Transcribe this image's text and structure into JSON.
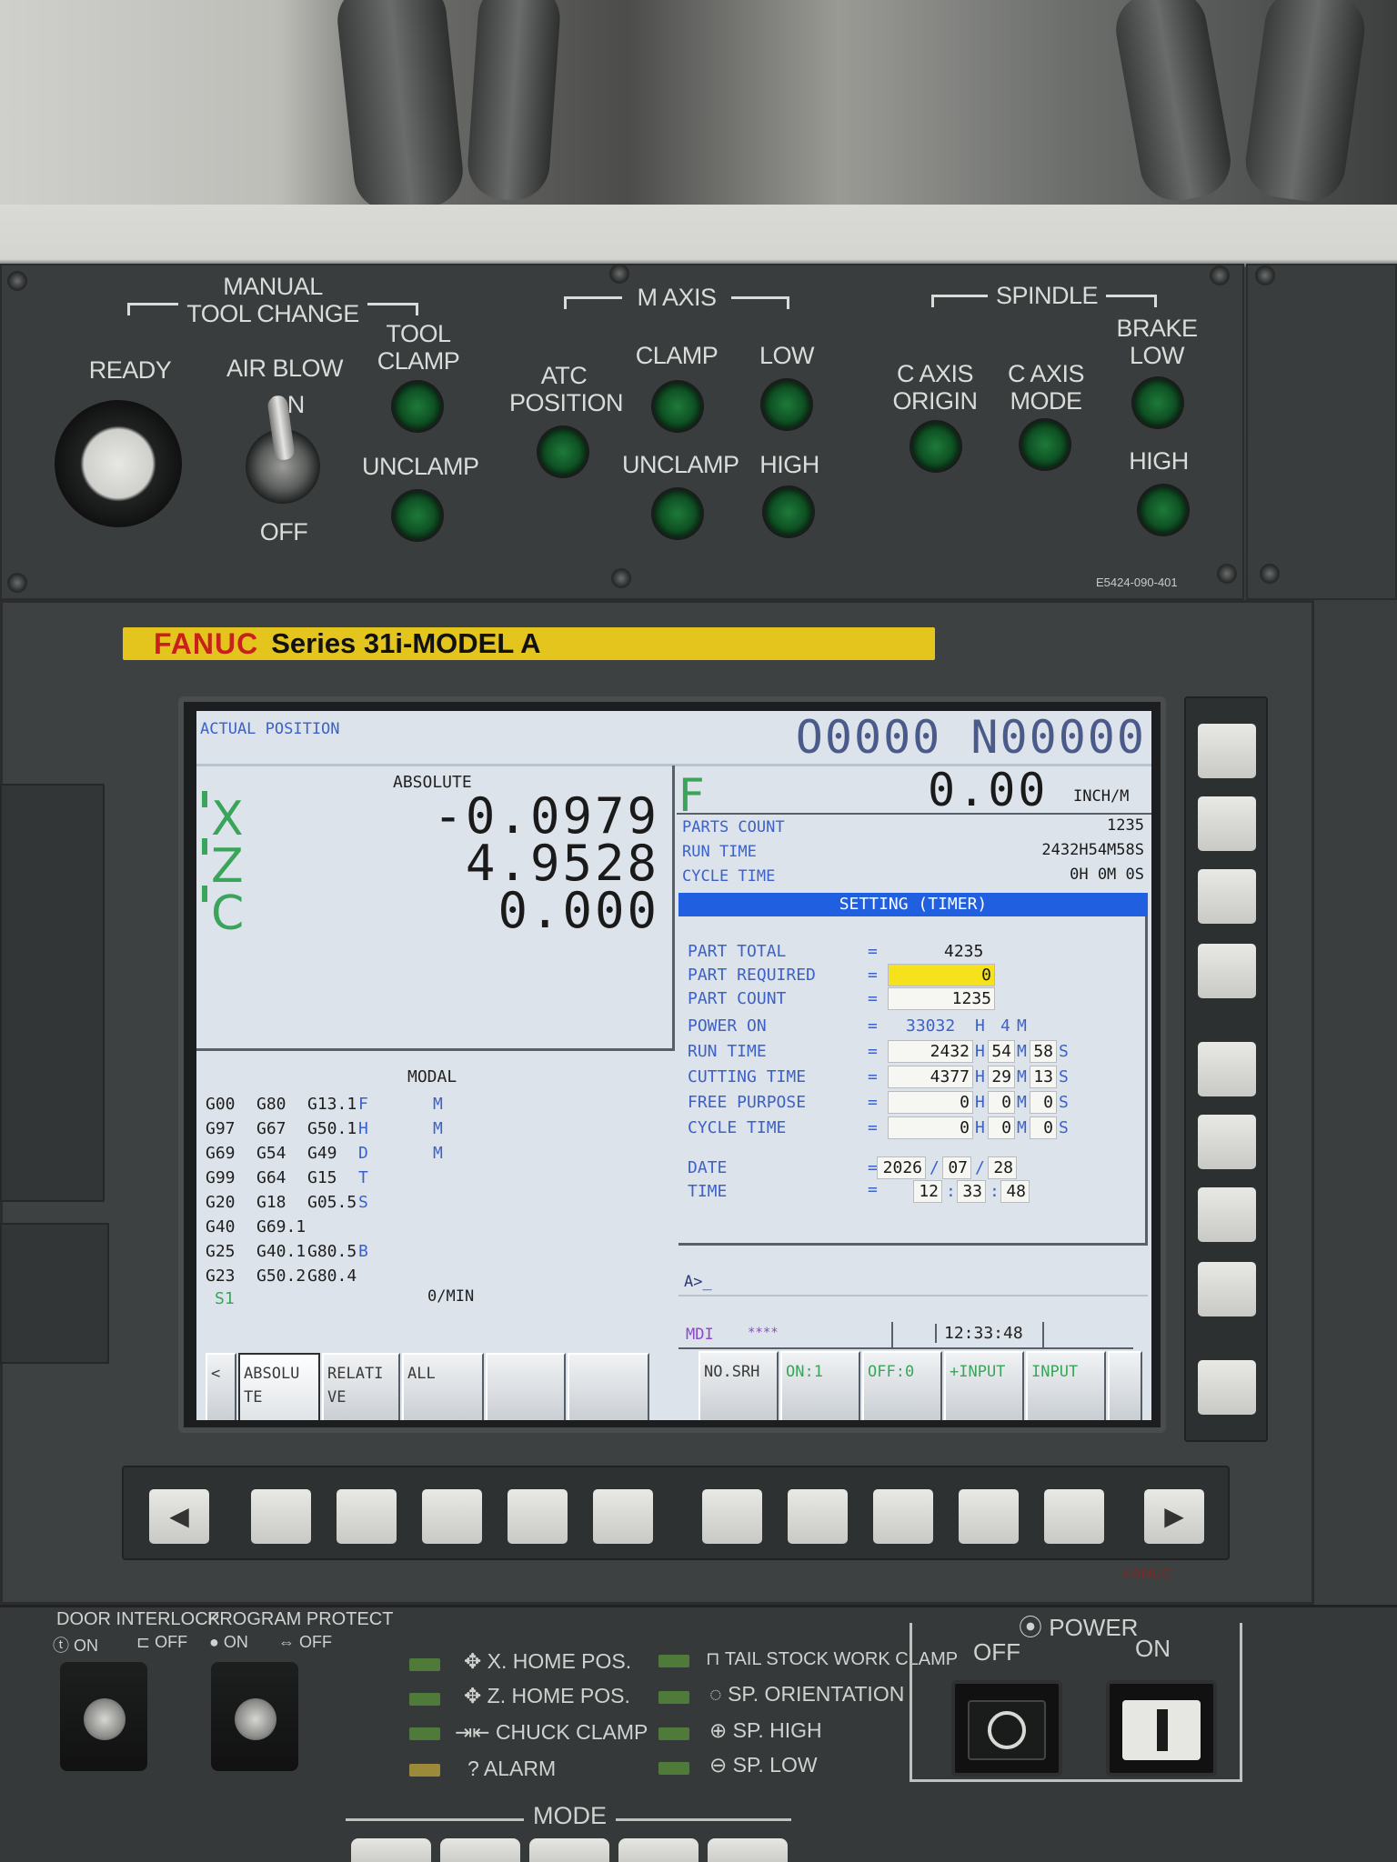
{
  "top_panel": {
    "manual_tool_change": [
      "MANUAL",
      "TOOL CHANGE"
    ],
    "ready": "READY",
    "air_blow": "AIR BLOW",
    "air_on": "ON",
    "air_off": "OFF",
    "tool_clamp": [
      "TOOL",
      "CLAMP"
    ],
    "tool_unclamp": "UNCLAMP",
    "m_axis": "M AXIS",
    "atc_position": [
      "ATC",
      "POSITION"
    ],
    "m_clamp": "CLAMP",
    "m_unclamp": "UNCLAMP",
    "m_low": "LOW",
    "m_high": "HIGH",
    "spindle": "SPINDLE",
    "c_axis_origin": [
      "C AXIS",
      "ORIGIN"
    ],
    "c_axis_mode": [
      "C AXIS",
      "MODE"
    ],
    "brake_low": [
      "BRAKE",
      "LOW"
    ],
    "brake_high": "HIGH",
    "part_code": "E5424-090-401"
  },
  "bezel": {
    "brand": "FANUC",
    "series": "Series 31i-MODEL A",
    "brand_small": "FANUC"
  },
  "screen": {
    "title": "ACTUAL POSITION",
    "program": "O0000 N00000",
    "position": {
      "label": "ABSOLUTE",
      "axes": [
        {
          "name": "X",
          "value": "-0.0979"
        },
        {
          "name": "Z",
          "value": "4.9528"
        },
        {
          "name": "C",
          "value": "0.000"
        }
      ]
    },
    "feed": {
      "label": "F",
      "value": "0.00",
      "unit": "INCH/M"
    },
    "counters": [
      {
        "label": "PARTS COUNT",
        "value": "1235"
      },
      {
        "label": "RUN TIME",
        "value": "2432H54M58S"
      },
      {
        "label": "CYCLE TIME",
        "value": "0H 0M 0S"
      }
    ],
    "modal": {
      "title": "MODAL",
      "rows": [
        [
          "G00",
          "G80",
          "G13.1",
          "F",
          "M"
        ],
        [
          "G97",
          "G67",
          "G50.1",
          "H",
          "M"
        ],
        [
          "G69",
          "G54",
          "G49",
          "D",
          "M"
        ],
        [
          "G99",
          "G64",
          "G15",
          "T",
          ""
        ],
        [
          "G20",
          "G18",
          "G05.5",
          "S",
          ""
        ],
        [
          "G40",
          "G69.1",
          "",
          "",
          ""
        ],
        [
          "G25",
          "G40.1",
          "G80.5",
          "B",
          ""
        ],
        [
          "G23",
          "G50.2",
          "G80.4",
          "",
          ""
        ]
      ],
      "spindle_label": "S1",
      "spindle_value": "0/MIN"
    },
    "setting": {
      "title": "SETTING (TIMER)",
      "part_total": {
        "label": "PART TOTAL",
        "value": "4235"
      },
      "part_required": {
        "label": "PART REQUIRED",
        "value": "0"
      },
      "part_count": {
        "label": "PART COUNT",
        "value": "1235"
      },
      "power_on": {
        "label": "POWER ON",
        "h": "33032",
        "m": "4"
      },
      "run_time": {
        "label": "RUN TIME",
        "h": "2432",
        "m": "54",
        "s": "58"
      },
      "cutting_time": {
        "label": "CUTTING TIME",
        "h": "4377",
        "m": "29",
        "s": "13"
      },
      "free_purpose": {
        "label": "FREE PURPOSE",
        "h": "0",
        "m": "0",
        "s": "0"
      },
      "cycle_time": {
        "label": "CYCLE TIME",
        "h": "0",
        "m": "0",
        "s": "0"
      },
      "date": {
        "label": "DATE",
        "y": "2026",
        "mo": "07",
        "d": "28"
      },
      "time": {
        "label": "TIME",
        "h": "12",
        "m": "33",
        "s": "48"
      },
      "eq": "=",
      "u_h": "H",
      "u_m": "M",
      "u_s": "S",
      "sep_date": "/",
      "sep_time": ":"
    },
    "input_prompt": "A>_",
    "status": {
      "mode": "MDI",
      "stars": "****",
      "time": "12:33:48"
    },
    "softkeys_left": [
      {
        "label": "<"
      },
      {
        "label": "ABSOLU\nTE"
      },
      {
        "label": "RELATI\nVE"
      },
      {
        "label": "ALL"
      },
      {
        "label": ""
      },
      {
        "label": ""
      }
    ],
    "softkeys_right": [
      {
        "label": "NO.SRH"
      },
      {
        "label": "ON:1"
      },
      {
        "label": "OFF:0"
      },
      {
        "label": "+INPUT"
      },
      {
        "label": "INPUT"
      }
    ]
  },
  "bottom_keys": {
    "left_arrow": "◀",
    "right_arrow": "▶"
  },
  "lower_panel": {
    "door_interlock": "DOOR INTERLOCK",
    "door_on": "ON",
    "door_off": "OFF",
    "program_protect": "PROGRAM PROTECT",
    "protect_on": "ON",
    "protect_off": "OFF",
    "indicators_left": [
      "X. HOME POS.",
      "Z. HOME POS.",
      "CHUCK CLAMP",
      "ALARM"
    ],
    "indicators_right": [
      "TAIL STOCK WORK CLAMP",
      "SP. ORIENTATION",
      "SP. HIGH",
      "SP. LOW"
    ],
    "power": "POWER",
    "power_off": "OFF",
    "power_on": "ON",
    "mode": "MODE"
  }
}
